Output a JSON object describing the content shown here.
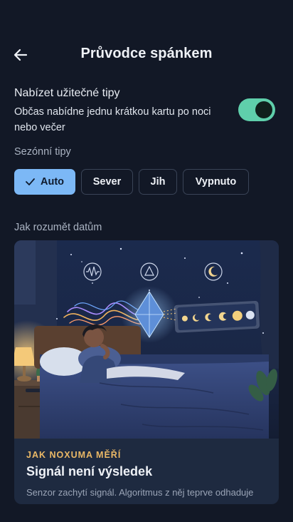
{
  "header": {
    "title": "Průvodce spánkem"
  },
  "tips": {
    "title": "Nabízet užitečné tipy",
    "description": "Občas nabídne jednu krátkou kartu po noci nebo večer",
    "enabled": true
  },
  "seasonal": {
    "label": "Sezónní tipy",
    "options": [
      "Auto",
      "Sever",
      "Jih",
      "Vypnuto"
    ],
    "selected": "Auto"
  },
  "data_section": {
    "label": "Jak rozumět datům"
  },
  "card": {
    "kicker": "JAK NOXUMA MĚŘÍ",
    "title": "Signál není výsledek",
    "text": "Senzor zachytí signál. Algoritmus z něj teprve odhaduje"
  },
  "colors": {
    "background": "#121826",
    "toggle_on": "#5fcfab",
    "chip_selected": "#7cb8f6",
    "kicker": "#eab866"
  }
}
